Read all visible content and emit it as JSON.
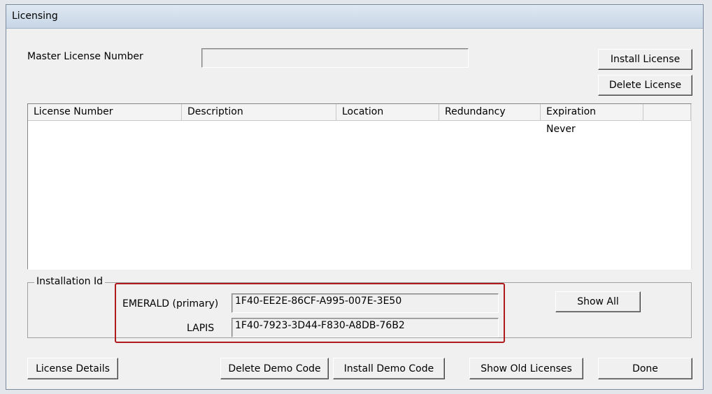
{
  "window": {
    "title": "Licensing"
  },
  "master": {
    "label": "Master License Number",
    "value": ""
  },
  "buttons": {
    "install_license": "Install License",
    "delete_license": "Delete License",
    "show_all": "Show All",
    "license_details": "License Details",
    "delete_demo_code": "Delete Demo Code",
    "install_demo_code": "Install Demo Code",
    "show_old_licenses": "Show Old Licenses",
    "done": "Done"
  },
  "table": {
    "headers": [
      "License Number",
      "Description",
      "Location",
      "Redundancy",
      "Expiration",
      ""
    ],
    "rows": [
      [
        "",
        "",
        "",
        "",
        "Never",
        ""
      ]
    ]
  },
  "installation": {
    "group_label": "Installation Id",
    "primary_label": "EMERALD (primary)",
    "primary_value": "1F40-EE2E-86CF-A995-007E-3E50",
    "secondary_label": "LAPIS",
    "secondary_value": "1F40-7923-3D44-F830-A8DB-76B2"
  },
  "colors": {
    "highlight": "#b11a1a"
  }
}
